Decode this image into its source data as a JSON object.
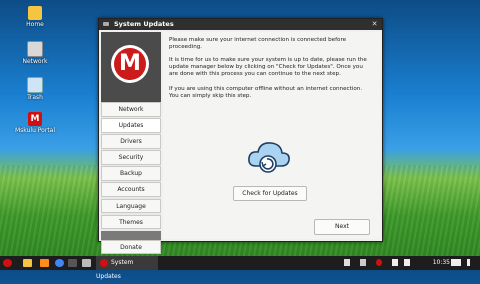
{
  "desktop": {
    "icons": [
      {
        "label": "Home"
      },
      {
        "label": "Network"
      },
      {
        "label": "Trash"
      },
      {
        "label": "Mskulu Portal"
      }
    ]
  },
  "window": {
    "title": "System Updates",
    "logo_letter": "M",
    "sidebar": {
      "items": [
        {
          "label": "Network"
        },
        {
          "label": "Updates"
        },
        {
          "label": "Drivers"
        },
        {
          "label": "Security"
        },
        {
          "label": "Backup"
        },
        {
          "label": "Accounts"
        },
        {
          "label": "Language"
        },
        {
          "label": "Themes"
        }
      ],
      "donate_label": "Donate"
    },
    "content": {
      "para1": "Please make sure your internet connection is connected before proceeding.",
      "para2": "It is time for us to make sure your system is up to date, please run the update manager below by clicking on \"Check for Updates\". Once you are done with this process you can continue to the next step.",
      "para3": "If you are using this computer offline without an internet connection. You can simply skip this step.",
      "check_button": "Check for Updates",
      "next_button": "Next"
    }
  },
  "taskbar": {
    "active_app": "System Updates",
    "clock": "10:35"
  },
  "colors": {
    "accent": "#cc1b1b",
    "titlebar": "#2f2f2f"
  }
}
